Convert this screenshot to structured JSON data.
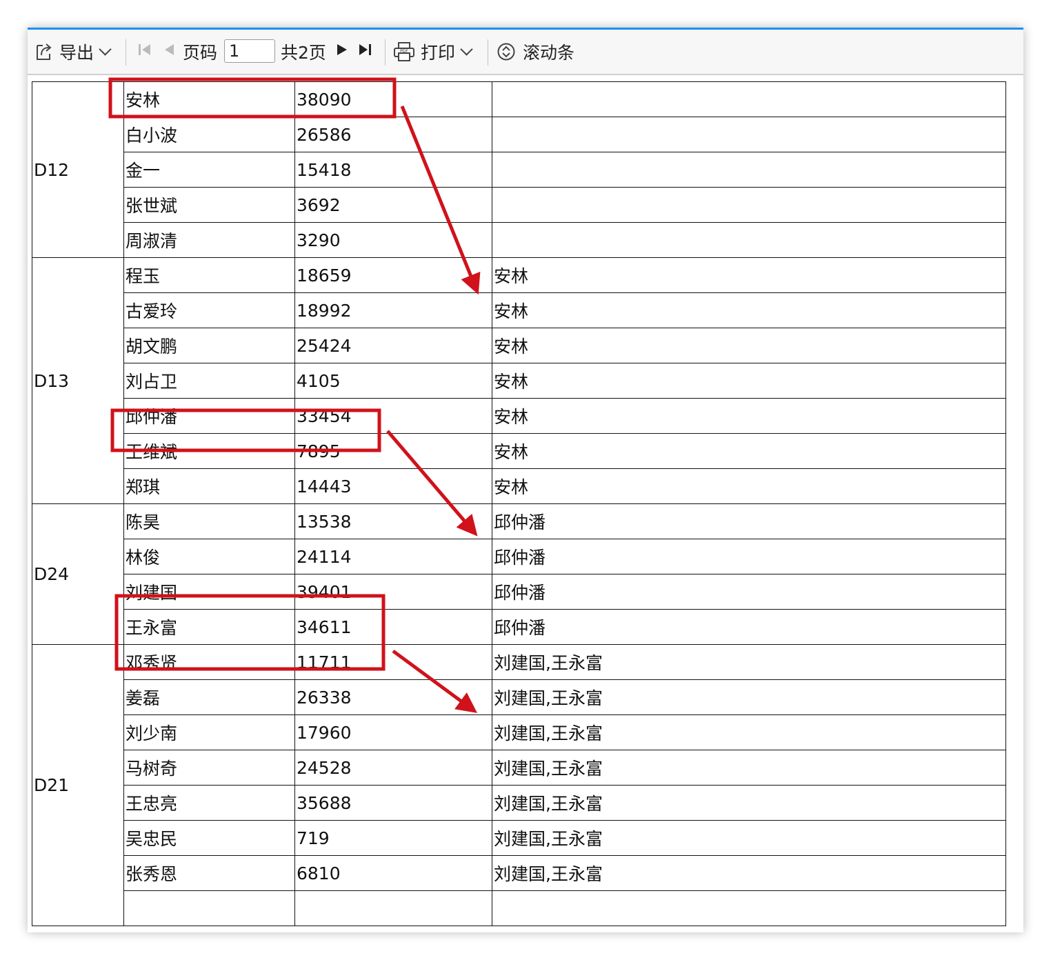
{
  "toolbar": {
    "export_label": "导出",
    "page_label": "页码",
    "page_value": "1",
    "total_pages_label": "共2页",
    "print_label": "打印",
    "scroll_label": "滚动条"
  },
  "groups": [
    {
      "code": "D12",
      "rows": [
        {
          "name": "安林",
          "value": "38090",
          "ref": ""
        },
        {
          "name": "白小波",
          "value": "26586",
          "ref": ""
        },
        {
          "name": "金一",
          "value": "15418",
          "ref": ""
        },
        {
          "name": "张世斌",
          "value": "3692",
          "ref": ""
        },
        {
          "name": "周淑清",
          "value": "3290",
          "ref": ""
        }
      ]
    },
    {
      "code": "D13",
      "rows": [
        {
          "name": "程玉",
          "value": "18659",
          "ref": "安林"
        },
        {
          "name": "古爱玲",
          "value": "18992",
          "ref": "安林"
        },
        {
          "name": "胡文鹏",
          "value": "25424",
          "ref": "安林"
        },
        {
          "name": "刘占卫",
          "value": "4105",
          "ref": "安林"
        },
        {
          "name": "邱仲潘",
          "value": "33454",
          "ref": "安林"
        },
        {
          "name": "王维斌",
          "value": "7895",
          "ref": "安林"
        },
        {
          "name": "郑琪",
          "value": "14443",
          "ref": "安林"
        }
      ]
    },
    {
      "code": "D24",
      "rows": [
        {
          "name": "陈昊",
          "value": "13538",
          "ref": "邱仲潘"
        },
        {
          "name": "林俊",
          "value": "24114",
          "ref": "邱仲潘"
        },
        {
          "name": "刘建国",
          "value": "39401",
          "ref": "邱仲潘"
        },
        {
          "name": "王永富",
          "value": "34611",
          "ref": "邱仲潘"
        }
      ]
    },
    {
      "code": "D21",
      "rows": [
        {
          "name": "邓秀贤",
          "value": "11711",
          "ref": "刘建国,王永富"
        },
        {
          "name": "姜磊",
          "value": "26338",
          "ref": "刘建国,王永富"
        },
        {
          "name": "刘少南",
          "value": "17960",
          "ref": "刘建国,王永富"
        },
        {
          "name": "马树奇",
          "value": "24528",
          "ref": "刘建国,王永富"
        },
        {
          "name": "王忠亮",
          "value": "35688",
          "ref": "刘建国,王永富"
        },
        {
          "name": "吴忠民",
          "value": "719",
          "ref": "刘建国,王永富"
        },
        {
          "name": "张秀恩",
          "value": "6810",
          "ref": "刘建国,王永富"
        },
        {
          "name": "",
          "value": "",
          "ref": ""
        }
      ]
    }
  ],
  "colors": {
    "accent": "#1e8ff0",
    "highlight": "#d0121b",
    "grid": "#111111"
  },
  "icons": [
    "export-icon",
    "first-page-icon",
    "prev-page-icon",
    "next-page-icon",
    "last-page-icon",
    "print-icon",
    "scroll-icon"
  ]
}
